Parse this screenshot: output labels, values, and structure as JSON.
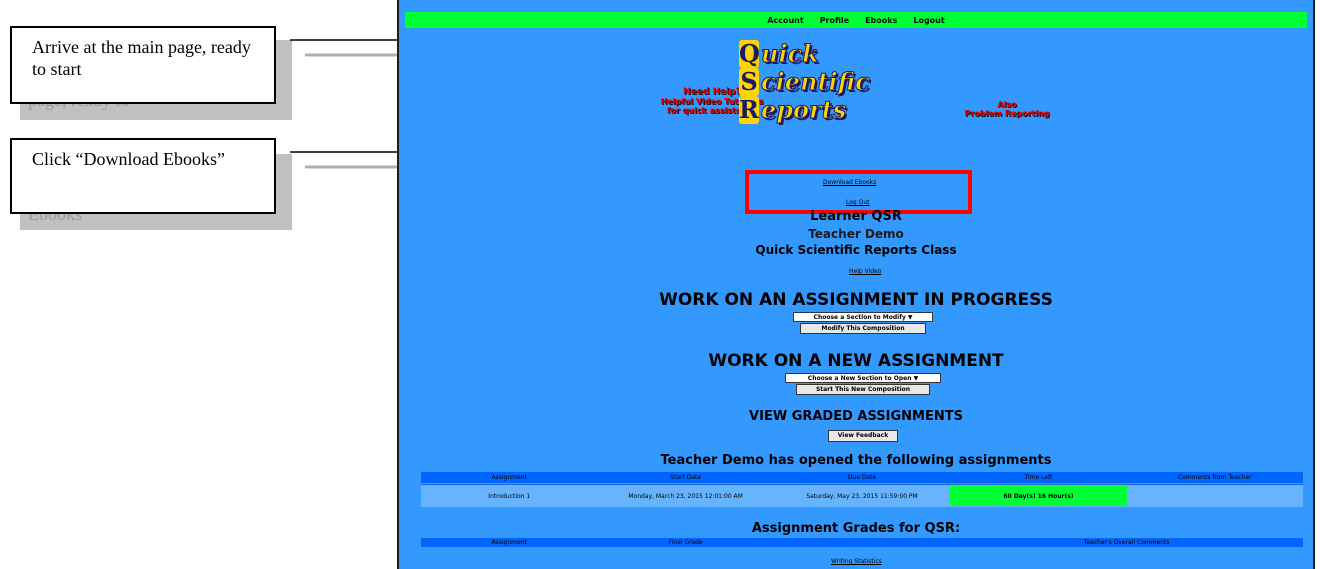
{
  "callouts": [
    {
      "text": "Arrive at the main page, ready to start",
      "ghost": "page, ready to"
    },
    {
      "text": "Click “Download Ebooks”",
      "ghost": "Ebooks"
    }
  ],
  "screen": {
    "topbar": [
      "Account",
      "Profile",
      "Ebooks",
      "Logout"
    ],
    "left_links": [
      "Need Help?",
      "Helpful Video Tutorials",
      "for quick assistance"
    ],
    "right_links": [
      "Also",
      "Problem Reporting"
    ],
    "logo": {
      "line1_letter": "Q",
      "line1_text": "uick",
      "line2_letter": "S",
      "line2_text": "cientific",
      "line3_letter": "R",
      "line3_text": "eports"
    },
    "download_link": "Download Ebooks",
    "logout_link": "Log Out",
    "learner": "Learner QSR",
    "teacher": "Teacher Demo",
    "class_name": "Quick Scientific Reports Class",
    "help_video": "Help Video",
    "work_in_progress": "WORK ON AN ASSIGNMENT IN PROGRESS",
    "select_modify": "Choose a Section to Modify ▼",
    "btn_modify": "Modify This Composition",
    "work_new": "WORK ON A NEW ASSIGNMENT",
    "select_new": "Choose a New Section to Open ▼",
    "btn_new": "Start This New Composition",
    "view_graded": "VIEW GRADED ASSIGNMENTS",
    "btn_feedback": "View Feedback",
    "opened_heading": "Teacher Demo  has opened the following assignments",
    "table_headers": [
      "Assignment",
      "Start Date",
      "Due Date",
      "Time Left",
      "Comments from Teacher"
    ],
    "table_row": {
      "assignment": "Introduction 1",
      "start": "Monday, March 23, 2015 12:01:00 AM",
      "due": "Saturday, May 23, 2015 11:59:00 PM",
      "time_left": "60 Day(s) 16 Hour(s)",
      "comments": ""
    },
    "grades_heading": "Assignment Grades for QSR:",
    "grades_headers": [
      "Assignment",
      "Final Grade",
      "",
      "Teacher's Overall Comments"
    ],
    "writing_stats": "Writing Statistics"
  },
  "colors": {
    "screen_bg": "#3399ff",
    "topbar": "#00ff33",
    "highlight": "#ff0000",
    "table_head": "#0066ff"
  }
}
